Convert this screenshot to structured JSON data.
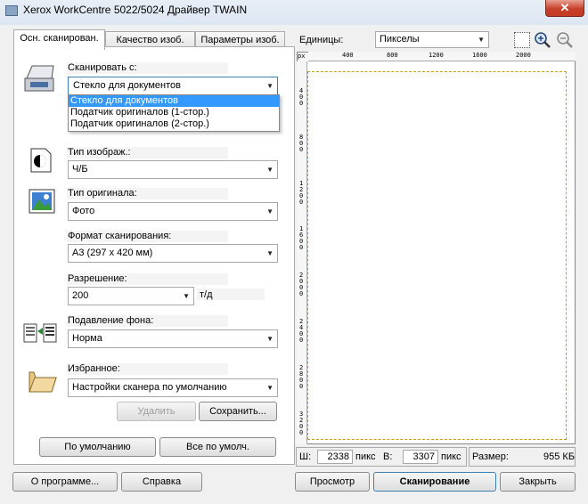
{
  "window": {
    "title": "Xerox WorkCentre 5022/5024 Драйвер TWAIN",
    "close_glyph": "✕"
  },
  "tabs": [
    {
      "label": "Осн. сканирован."
    },
    {
      "label": "Качество изоб."
    },
    {
      "label": "Параметры изоб."
    }
  ],
  "scan_from": {
    "label": "Сканировать с:",
    "value": "Стекло для документов",
    "options": [
      "Стекло для документов",
      "Податчик оригиналов (1-стор.)",
      "Податчик оригиналов (2-стор.)"
    ]
  },
  "image_type": {
    "label": "Тип изображ.:",
    "value": "Ч/Б"
  },
  "original_type": {
    "label": "Тип оригинала:",
    "value": "Фото"
  },
  "scan_size": {
    "label": "Формат сканирования:",
    "value": "A3 (297 x 420 мм)"
  },
  "resolution": {
    "label": "Разрешение:",
    "value": "200",
    "unit": "т/д"
  },
  "background_suppression": {
    "label": "Подавление фона:",
    "value": "Норма"
  },
  "favorites": {
    "label": "Избранное:",
    "value": "Настройки сканера по умолчанию",
    "delete_label": "Удалить",
    "save_label": "Сохранить..."
  },
  "defaults": {
    "default_label": "По умолчанию",
    "all_default_label": "Все по умолч."
  },
  "units": {
    "label": "Единицы:",
    "value": "Пикселы"
  },
  "ruler": {
    "unit": "px",
    "h_ticks": [
      "400",
      "800",
      "1200",
      "1600",
      "2000"
    ],
    "v_ticks": [
      "400",
      "800",
      "1200",
      "1600",
      "2000",
      "2400",
      "2800",
      "3200"
    ]
  },
  "status": {
    "width_label": "Ш:",
    "width_value": "2338",
    "width_unit": "пикс",
    "height_label": "В:",
    "height_value": "3307",
    "height_unit": "пикс",
    "size_label": "Размер:",
    "size_value": "955 КБ"
  },
  "footer": {
    "about_label": "О программе...",
    "help_label": "Справка",
    "preview_label": "Просмотр",
    "scan_label": "Сканирование",
    "close_label": "Закрыть"
  }
}
